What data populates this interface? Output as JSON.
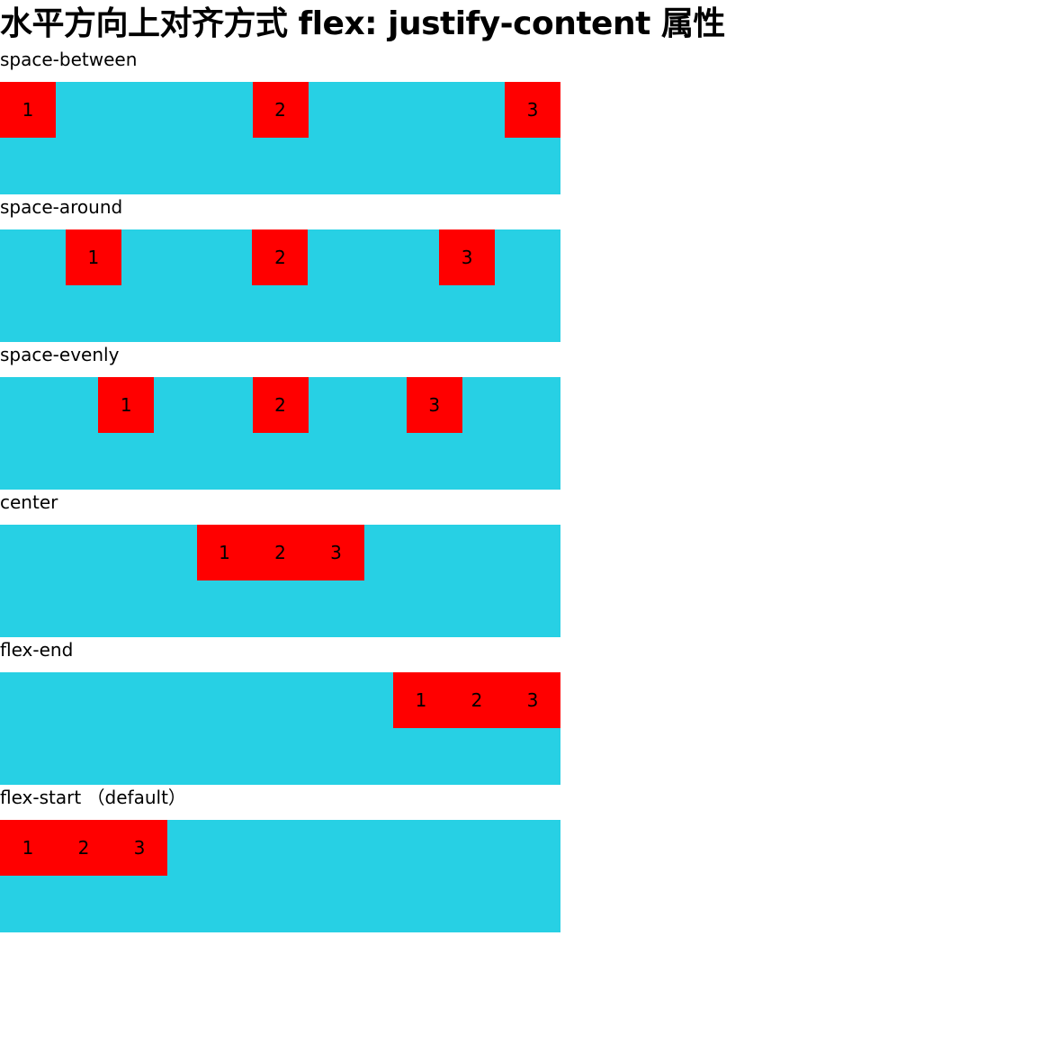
{
  "title": "水平方向上对齐方式 flex: justify-content 属性",
  "colors": {
    "container_background": "#27d0e4",
    "item_background": "#ff0000"
  },
  "demos": [
    {
      "label": "space-between",
      "justify": "space-between",
      "items": [
        "1",
        "2",
        "3"
      ]
    },
    {
      "label": "space-around",
      "justify": "space-around",
      "items": [
        "1",
        "2",
        "3"
      ]
    },
    {
      "label": "space-evenly",
      "justify": "space-evenly",
      "items": [
        "1",
        "2",
        "3"
      ]
    },
    {
      "label": "center",
      "justify": "center",
      "items": [
        "1",
        "2",
        "3"
      ]
    },
    {
      "label": "flex-end",
      "justify": "flex-end",
      "items": [
        "1",
        "2",
        "3"
      ]
    },
    {
      "label": "flex-start （default）",
      "justify": "flex-start",
      "items": [
        "1",
        "2",
        "3"
      ]
    }
  ]
}
